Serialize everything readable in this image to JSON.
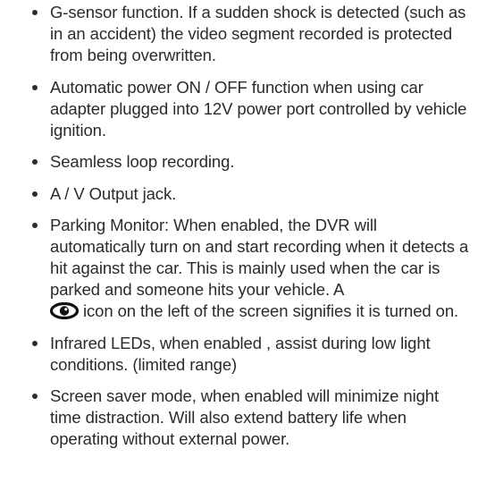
{
  "bullets": [
    {
      "text": "G-sensor function. If a sudden shock is detected (such as in an accident) the video segment recorded is protected from being overwritten."
    },
    {
      "text": "Automatic power ON / OFF function when using car adapter plugged into 12V power port controlled by vehicle ignition."
    },
    {
      "text": "Seamless loop recording."
    },
    {
      "text": "A / V Output jack."
    },
    {
      "text_before": "Parking Monitor: When enabled, the DVR will automatically turn on and start recording when it detects a hit against the car. This is mainly used when the car is parked and someone hits your vehicle.  A",
      "icon": "eye-icon",
      "text_after": "icon on the left of the screen signifies it is turned on."
    },
    {
      "text": "Infrared LEDs, when enabled , assist during low light conditions. (limited range)"
    },
    {
      "text": "Screen saver mode, when enabled will minimize night time distraction. Will also extend battery life when operating without external power."
    }
  ]
}
